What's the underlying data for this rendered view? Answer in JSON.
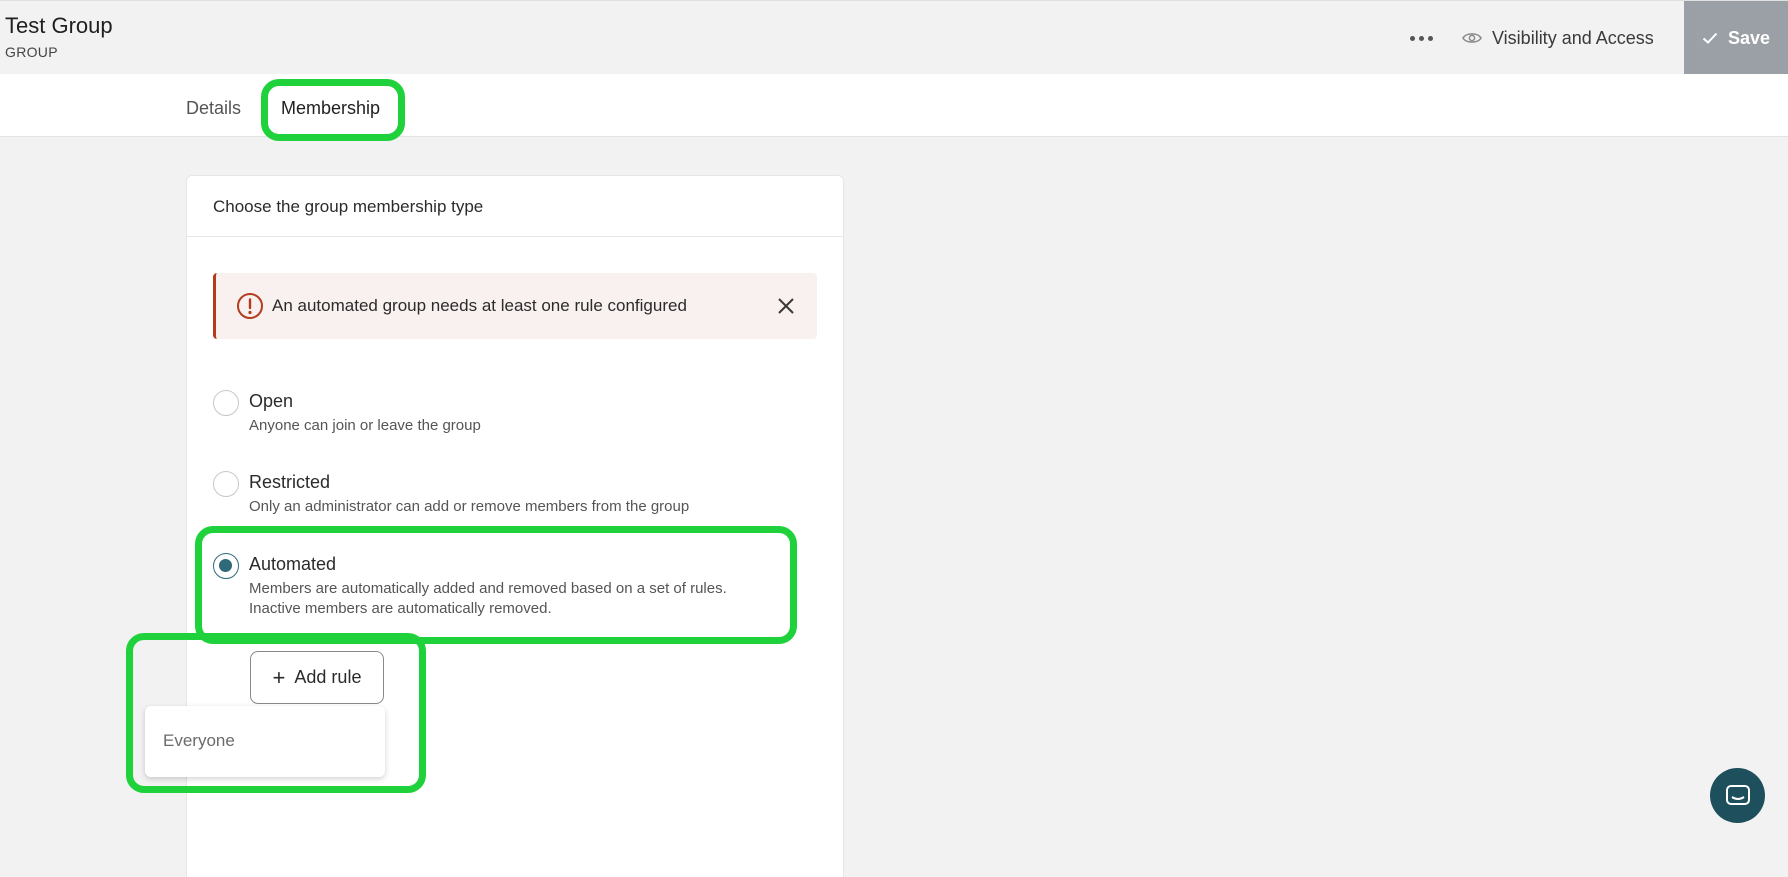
{
  "header": {
    "title": "Test Group",
    "subtitle": "GROUP",
    "more_icon": "more-horizontal-icon",
    "visibility_label": "Visibility and Access",
    "visibility_icon": "eye-icon",
    "save_label": "Save",
    "save_icon": "check-icon"
  },
  "tabs": [
    {
      "label": "Details",
      "active": false
    },
    {
      "label": "Membership",
      "active": true
    }
  ],
  "card": {
    "title": "Choose the group membership type",
    "alert": {
      "text": "An automated group needs at least one rule configured",
      "icon": "error-circle-icon",
      "close_icon": "close-icon",
      "accent_color": "#b23c1c"
    },
    "options": [
      {
        "label": "Open",
        "description": "Anyone can join or leave the group",
        "selected": false
      },
      {
        "label": "Restricted",
        "description": "Only an administrator can add or remove members from the group",
        "selected": false
      },
      {
        "label": "Automated",
        "description_line1": "Members are automatically added and removed based on a set of rules.",
        "description_line2": "Inactive members are automatically removed.",
        "selected": true
      }
    ],
    "add_rule_label": "Add rule",
    "dropdown_items": [
      "Everyone"
    ]
  },
  "highlight_color": "#1fd23c",
  "chat_icon": "chat-icon"
}
